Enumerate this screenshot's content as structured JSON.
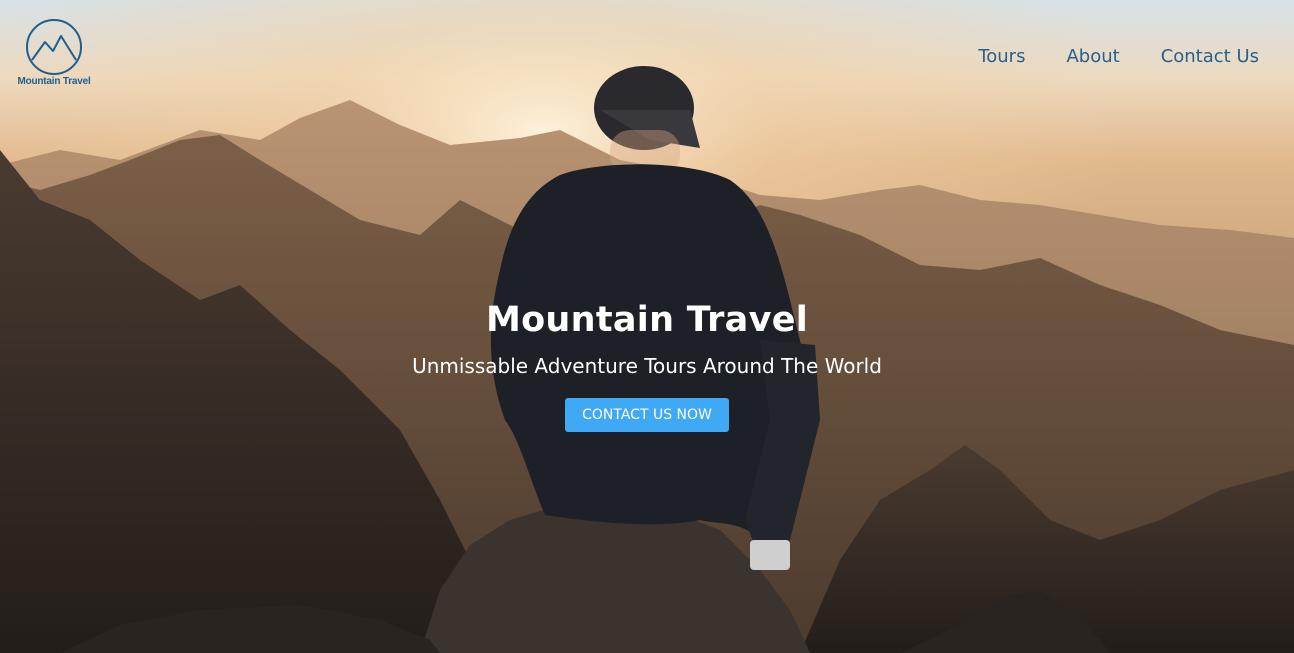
{
  "brand": {
    "name": "Mountain Travel",
    "logo_icon": "mountain-peaks-circle-icon",
    "color": "#1f5f8f"
  },
  "nav": {
    "items": [
      {
        "label": "Tours"
      },
      {
        "label": "About"
      },
      {
        "label": "Contact Us"
      }
    ],
    "color": "#2b5f8a"
  },
  "hero": {
    "title": "Mountain Travel",
    "subtitle": "Unmissable Adventure Tours Around The World",
    "cta_label": "CONTACT US NOW",
    "cta_color": "#3fa9f5",
    "background_image": "hiker-sitting-on-mountain-peak-at-sunset"
  }
}
